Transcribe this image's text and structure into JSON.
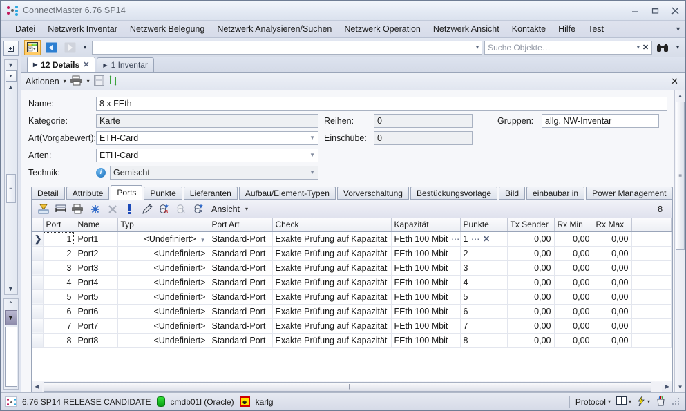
{
  "window": {
    "title": "ConnectMaster 6.76 SP14",
    "logo_icon": "connectmaster-logo",
    "minimize_label": "–",
    "maximize_label": "□",
    "close_label": "✕"
  },
  "menubar": {
    "items": [
      {
        "label": "Datei",
        "name": "menu-datei"
      },
      {
        "label": "Netzwerk Inventar",
        "name": "menu-netzwerk-inventar"
      },
      {
        "label": "Netzwerk Belegung",
        "name": "menu-netzwerk-belegung"
      },
      {
        "label": "Netzwerk Analysieren/Suchen",
        "name": "menu-netzwerk-analysieren-suchen"
      },
      {
        "label": "Netzwerk Operation",
        "name": "menu-netzwerk-operation"
      },
      {
        "label": "Netzwerk Ansicht",
        "name": "menu-netzwerk-ansicht"
      },
      {
        "label": "Kontakte",
        "name": "menu-kontakte"
      },
      {
        "label": "Hilfe",
        "name": "menu-hilfe"
      },
      {
        "label": "Test",
        "name": "menu-test"
      }
    ],
    "overflow_icon": "chevron-down-icon"
  },
  "toolbar": {
    "new_object_icon": "new-object-icon",
    "back_icon": "back-arrow-icon",
    "forward_icon": "forward-arrow-icon",
    "history_caret": "▾",
    "address_value": "",
    "address_caret": "▾",
    "search_placeholder": "Suche Objekte…",
    "search_value": "",
    "search_caret": "▾",
    "search_clear": "✕",
    "find_icon": "binoculars-icon",
    "find_caret": "▾"
  },
  "doctabs": [
    {
      "label": "12 Details",
      "selected": true,
      "closable": true,
      "name": "doctab-details"
    },
    {
      "label": "1 Inventar",
      "selected": false,
      "closable": false,
      "name": "doctab-inventar"
    }
  ],
  "actionbar": {
    "actions_label": "Aktionen",
    "actions_caret": "▾",
    "print_icon": "printer-icon",
    "print_caret": "▾",
    "save_icon": "save-icon",
    "refresh_icon": "refresh-icon",
    "close_label": "✕"
  },
  "form": {
    "name": {
      "label": "Name:",
      "value": "8 x FEth"
    },
    "kategorie": {
      "label": "Kategorie:",
      "value": "Karte"
    },
    "art_vorgabewert": {
      "label": "Art(Vorgabewert):",
      "value": "ETH-Card"
    },
    "arten": {
      "label": "Arten:",
      "value": "ETH-Card"
    },
    "technik": {
      "label": "Technik:",
      "value": "Gemischt",
      "icon": "info-icon"
    },
    "reihen": {
      "label": "Reihen:",
      "value": "0"
    },
    "einschuebe": {
      "label": "Einschübe:",
      "value": "0"
    },
    "gruppen": {
      "label": "Gruppen:",
      "value": "allg. NW-Inventar"
    }
  },
  "tabstrip": {
    "tabs": [
      {
        "label": "Detail",
        "selected": false,
        "name": "tab-detail"
      },
      {
        "label": "Attribute",
        "selected": false,
        "name": "tab-attribute"
      },
      {
        "label": "Ports",
        "selected": true,
        "name": "tab-ports"
      },
      {
        "label": "Punkte",
        "selected": false,
        "name": "tab-punkte"
      },
      {
        "label": "Lieferanten",
        "selected": false,
        "name": "tab-lieferanten"
      },
      {
        "label": "Aufbau/Element-Typen",
        "selected": false,
        "name": "tab-aufbau-element-typen"
      },
      {
        "label": "Vorverschaltung",
        "selected": false,
        "name": "tab-vorverschaltung"
      },
      {
        "label": "Bestückungsvorlage",
        "selected": false,
        "name": "tab-bestueckungsvorlage"
      },
      {
        "label": "Bild",
        "selected": false,
        "name": "tab-bild"
      },
      {
        "label": "einbaubar in",
        "selected": false,
        "name": "tab-einbaubar-in"
      },
      {
        "label": "Power Management",
        "selected": false,
        "name": "tab-power-management"
      }
    ]
  },
  "gridtoolbar": {
    "icons": [
      {
        "name": "filter-icon"
      },
      {
        "name": "fit-columns-icon"
      },
      {
        "name": "print-grid-icon"
      },
      {
        "name": "snowflake-icon"
      },
      {
        "name": "delete-row-icon"
      },
      {
        "name": "exclamation-icon"
      },
      {
        "name": "pencil-icon"
      },
      {
        "name": "group-g-icon"
      },
      {
        "name": "group-s-icon"
      },
      {
        "name": "group-p-icon"
      }
    ],
    "view_label": "Ansicht",
    "view_caret": "▾",
    "record_count": "8"
  },
  "grid": {
    "columns": [
      {
        "key": "sel",
        "label": "",
        "align": "center"
      },
      {
        "key": "port",
        "label": "Port",
        "align": "right"
      },
      {
        "key": "name",
        "label": "Name",
        "align": "left"
      },
      {
        "key": "typ",
        "label": "Typ",
        "align": "right"
      },
      {
        "key": "art",
        "label": "Port Art",
        "align": "left"
      },
      {
        "key": "check",
        "label": "Check",
        "align": "left"
      },
      {
        "key": "kap",
        "label": "Kapazität",
        "align": "left"
      },
      {
        "key": "punkte",
        "label": "Punkte",
        "align": "left"
      },
      {
        "key": "tx",
        "label": "Tx Sender",
        "align": "right"
      },
      {
        "key": "rxmin",
        "label": "Rx Min",
        "align": "right"
      },
      {
        "key": "rxmax",
        "label": "Rx Max",
        "align": "right"
      },
      {
        "key": "fill",
        "label": "",
        "align": "left"
      }
    ],
    "rows": [
      {
        "sel": "❯",
        "port": "1",
        "name": "Port1",
        "typ": "<Undefiniert>",
        "art": "Standard-Port",
        "check": "Exakte Prüfung auf Kapazität",
        "kap": "FEth 100 Mbit",
        "punkte": "1",
        "tx": "0,00",
        "rxmin": "0,00",
        "rxmax": "0,00",
        "editing": true
      },
      {
        "sel": "",
        "port": "2",
        "name": "Port2",
        "typ": "<Undefiniert>",
        "art": "Standard-Port",
        "check": "Exakte Prüfung auf Kapazität",
        "kap": "FEth 100 Mbit",
        "punkte": "2",
        "tx": "0,00",
        "rxmin": "0,00",
        "rxmax": "0,00",
        "editing": false
      },
      {
        "sel": "",
        "port": "3",
        "name": "Port3",
        "typ": "<Undefiniert>",
        "art": "Standard-Port",
        "check": "Exakte Prüfung auf Kapazität",
        "kap": "FEth 100 Mbit",
        "punkte": "3",
        "tx": "0,00",
        "rxmin": "0,00",
        "rxmax": "0,00",
        "editing": false
      },
      {
        "sel": "",
        "port": "4",
        "name": "Port4",
        "typ": "<Undefiniert>",
        "art": "Standard-Port",
        "check": "Exakte Prüfung auf Kapazität",
        "kap": "FEth 100 Mbit",
        "punkte": "4",
        "tx": "0,00",
        "rxmin": "0,00",
        "rxmax": "0,00",
        "editing": false
      },
      {
        "sel": "",
        "port": "5",
        "name": "Port5",
        "typ": "<Undefiniert>",
        "art": "Standard-Port",
        "check": "Exakte Prüfung auf Kapazität",
        "kap": "FEth 100 Mbit",
        "punkte": "5",
        "tx": "0,00",
        "rxmin": "0,00",
        "rxmax": "0,00",
        "editing": false
      },
      {
        "sel": "",
        "port": "6",
        "name": "Port6",
        "typ": "<Undefiniert>",
        "art": "Standard-Port",
        "check": "Exakte Prüfung auf Kapazität",
        "kap": "FEth 100 Mbit",
        "punkte": "6",
        "tx": "0,00",
        "rxmin": "0,00",
        "rxmax": "0,00",
        "editing": false
      },
      {
        "sel": "",
        "port": "7",
        "name": "Port7",
        "typ": "<Undefiniert>",
        "art": "Standard-Port",
        "check": "Exakte Prüfung auf Kapazität",
        "kap": "FEth 100 Mbit",
        "punkte": "7",
        "tx": "0,00",
        "rxmin": "0,00",
        "rxmax": "0,00",
        "editing": false
      },
      {
        "sel": "",
        "port": "8",
        "name": "Port8",
        "typ": "<Undefiniert>",
        "art": "Standard-Port",
        "check": "Exakte Prüfung auf Kapazität",
        "kap": "FEth 100 Mbit",
        "punkte": "8",
        "tx": "0,00",
        "rxmin": "0,00",
        "rxmax": "0,00",
        "editing": false
      }
    ]
  },
  "statusbar": {
    "logo_icon": "connectmaster-logo",
    "version": "6.76 SP14 RELEASE CANDIDATE",
    "db_icon": "database-icon",
    "database": "cmdb01l (Oracle)",
    "user_icon": "user-icon",
    "user": "karlg",
    "protocol_label": "Protocol",
    "protocol_caret": "▾",
    "layout_icon": "layout-icon",
    "layout_caret": "▾",
    "flash_icon": "lightning-icon",
    "flash_caret": "▾",
    "tools_icon": "pencil-cup-icon",
    "resize_grip": "resize-grip"
  },
  "colors": {
    "accent": "#ffc85e",
    "chrome": "#d6dbe9",
    "selection": "#cbd6ea",
    "logo_red": "#c2185b",
    "logo_blue": "#2196f3",
    "status_db_green": "#0aa015",
    "status_user_yellow": "#ffe300"
  }
}
